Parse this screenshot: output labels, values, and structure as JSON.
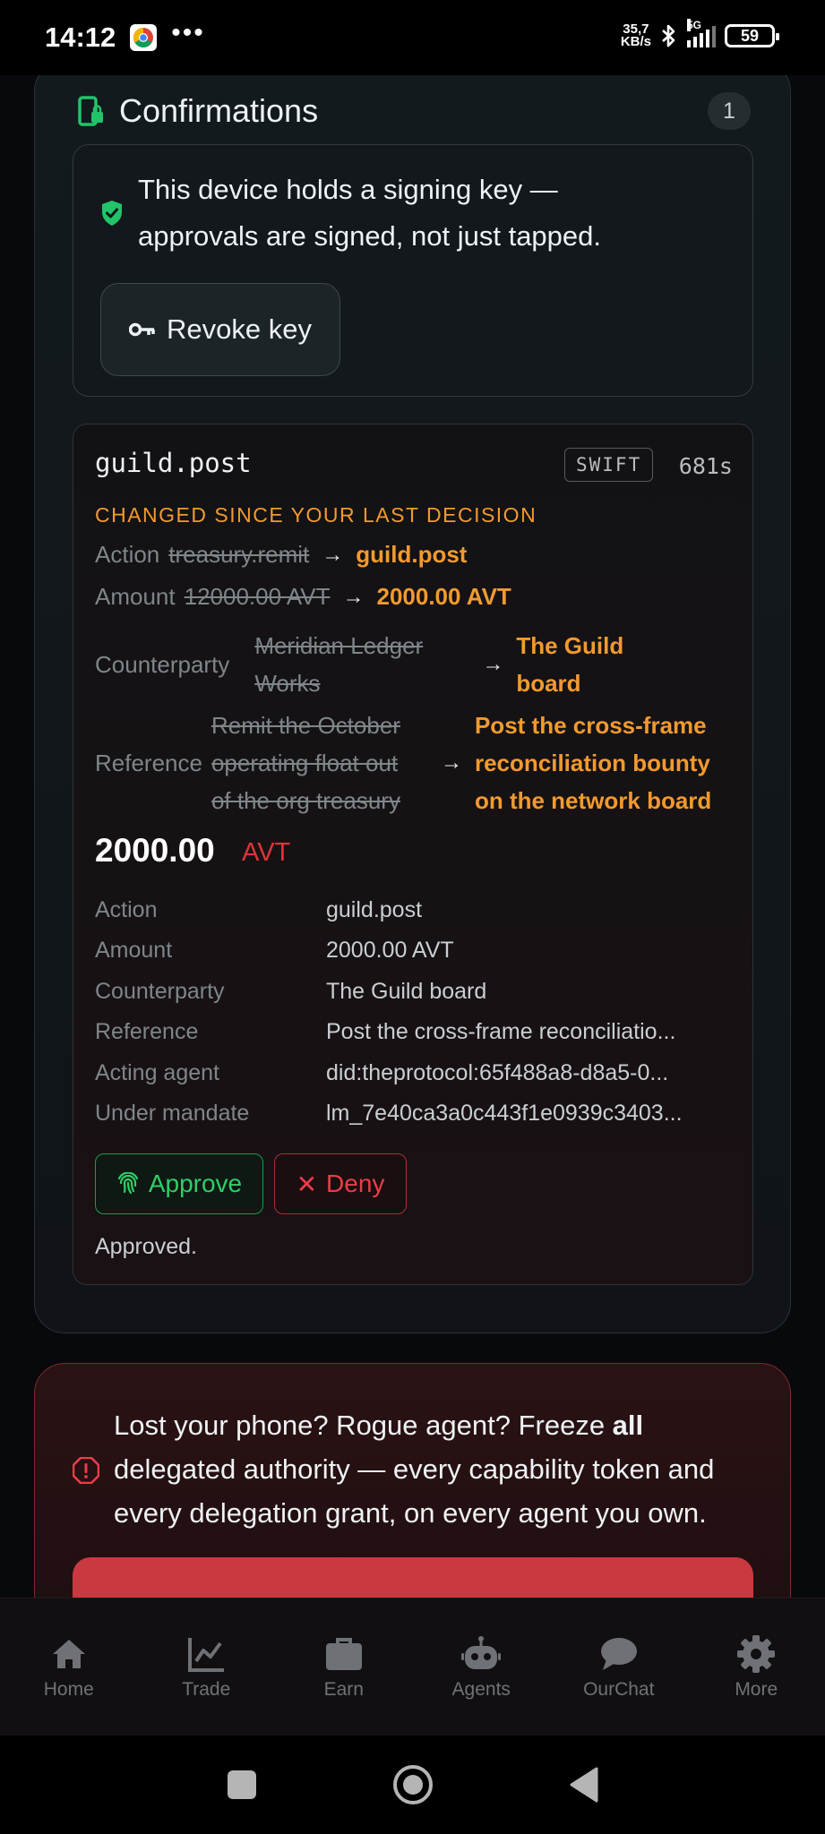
{
  "status_bar": {
    "time": "14:12",
    "net_speed_top": "35,7",
    "net_speed_bottom": "KB/s",
    "network": "5G",
    "battery": "59"
  },
  "confirmations": {
    "title": "Confirmations",
    "count": "1",
    "key_notice_line1": "This device holds a signing key —",
    "key_notice_line2": "approvals are signed, not just tapped.",
    "revoke_label": "Revoke key"
  },
  "request": {
    "action": "guild.post",
    "speed_badge": "SWIFT",
    "ttl": "681s",
    "changed_banner": "CHANGED SINCE YOUR LAST DECISION",
    "diff": {
      "action": {
        "label": "Action",
        "old": "treasury.remit",
        "new": "guild.post"
      },
      "amount": {
        "label": "Amount",
        "old": "12000.00 AVT",
        "new": "2000.00 AVT"
      },
      "counterparty": {
        "label": "Counterparty",
        "old_line1": "Meridian Ledger",
        "old_line2": "Works",
        "new_line1": "The Guild",
        "new_line2": "board"
      },
      "reference": {
        "label": "Reference",
        "old_line1": "Remit the October",
        "old_line2": "operating float out",
        "old_line3": "of the org treasury",
        "new_line1": "Post the cross-frame",
        "new_line2": "reconciliation bounty",
        "new_line3": "on the network board"
      }
    },
    "amount_value": "2000.00",
    "amount_unit": "AVT",
    "details": [
      {
        "label": "Action",
        "value": "guild.post"
      },
      {
        "label": "Amount",
        "value": "2000.00 AVT"
      },
      {
        "label": "Counterparty",
        "value": "The Guild board"
      },
      {
        "label": "Reference",
        "value": "Post the cross-frame reconciliatio..."
      },
      {
        "label": "Acting agent",
        "value": "did:theprotocol:65f488a8-d8a5-0..."
      },
      {
        "label": "Under mandate",
        "value": "lm_7e40ca3a0c443f1e0939c3403..."
      }
    ],
    "approve_label": "Approve",
    "deny_label": "Deny",
    "status_text": "Approved."
  },
  "freeze": {
    "text_before": "Lost your phone? Rogue agent? Freeze ",
    "text_bold": "all",
    "text_after": " delegated authority — every capability token and every delegation grant, on every agent you own."
  },
  "bottom_nav": [
    {
      "label": "Home",
      "icon": "home-icon"
    },
    {
      "label": "Trade",
      "icon": "chart-icon"
    },
    {
      "label": "Earn",
      "icon": "briefcase-icon"
    },
    {
      "label": "Agents",
      "icon": "robot-icon"
    },
    {
      "label": "OurChat",
      "icon": "chat-icon"
    },
    {
      "label": "More",
      "icon": "gear-icon"
    }
  ],
  "colors": {
    "accent_orange": "#f29a2e",
    "approve_green": "#2fcf68",
    "deny_red": "#ea3d48",
    "shield_green": "#22c36a"
  }
}
